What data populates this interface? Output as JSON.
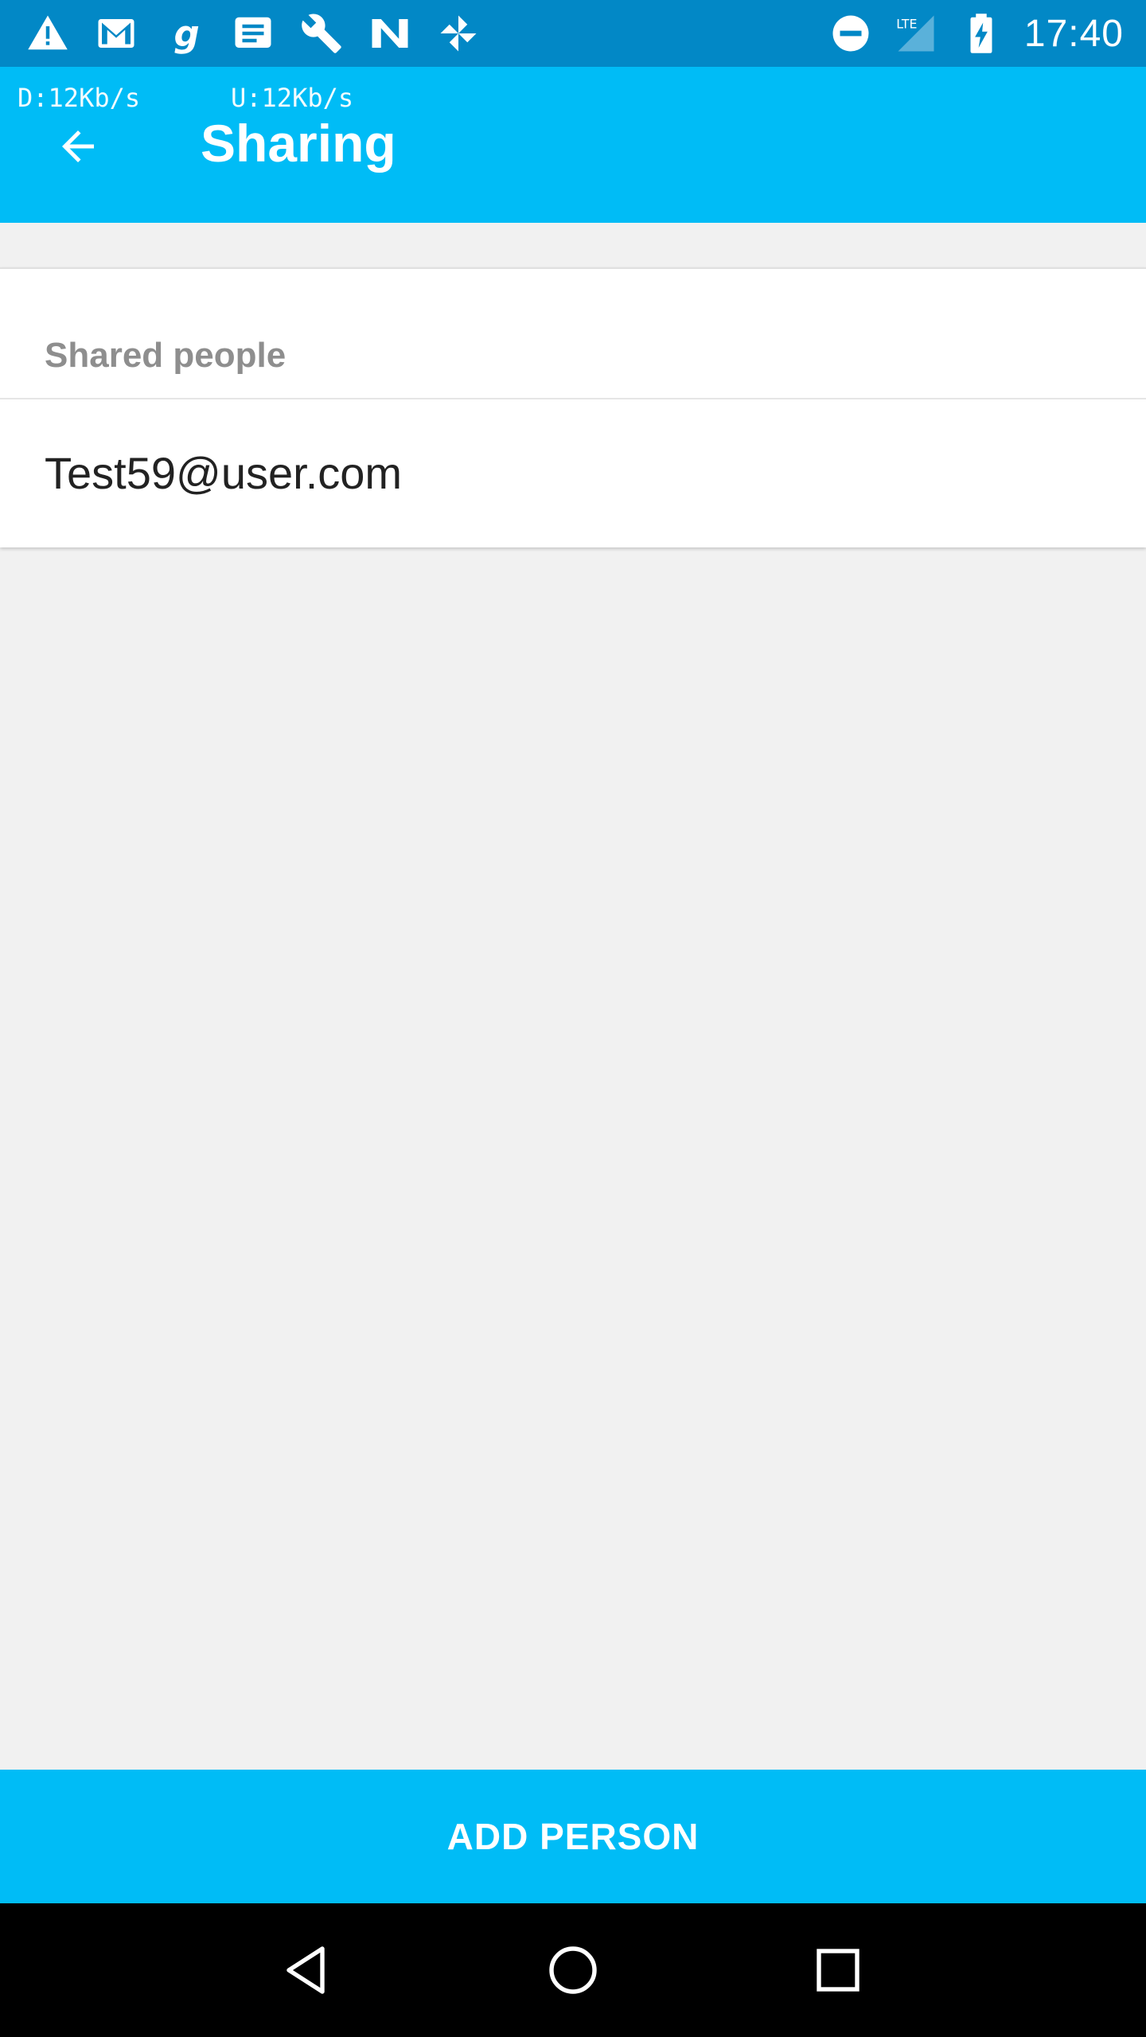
{
  "status_bar": {
    "time": "17:40",
    "network_label": "LTE",
    "left_icons": [
      "warning-icon",
      "gmail-icon",
      "g-app-icon",
      "message-icon",
      "wrench-icon",
      "n-app-icon",
      "pinwheel-icon"
    ],
    "right_icons": [
      "do-not-disturb-icon",
      "signal-icon",
      "battery-charging-icon"
    ]
  },
  "app_bar": {
    "download_speed": "D:12Kb/s",
    "upload_speed": "U:12Kb/s",
    "title": "Sharing"
  },
  "card": {
    "header_label": "Shared people",
    "people": [
      "Test59@user.com"
    ]
  },
  "add_button_label": "ADD PERSON",
  "colors": {
    "status_bar": "#0288c6",
    "accent": "#00bcf6",
    "background": "#f1f1f1"
  }
}
